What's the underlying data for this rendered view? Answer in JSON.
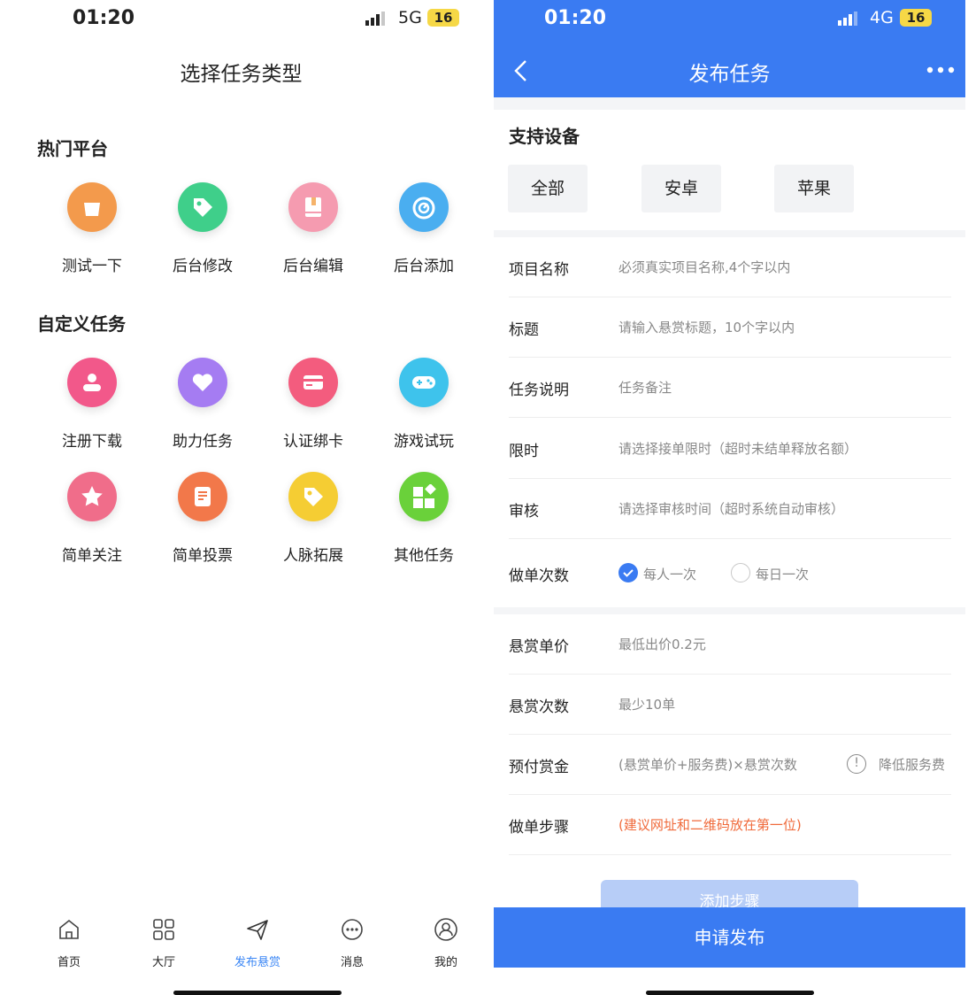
{
  "left": {
    "status": {
      "time": "01:20",
      "network": "5G",
      "battery": "16"
    },
    "title": "选择任务类型",
    "hot_title": "热门平台",
    "hot_items": [
      {
        "label": "测试一下",
        "icon": "shopping-bag-icon",
        "color": "#f39a4c"
      },
      {
        "label": "后台修改",
        "icon": "tag-icon",
        "color": "#3fcf8a"
      },
      {
        "label": "后台编辑",
        "icon": "book-icon",
        "color": "#f59bb0"
      },
      {
        "label": "后台添加",
        "icon": "gauge-icon",
        "color": "#4aaef0"
      }
    ],
    "custom_title": "自定义任务",
    "custom_items": [
      {
        "label": "注册下载",
        "icon": "user-icon",
        "color": "#f2588a"
      },
      {
        "label": "助力任务",
        "icon": "heart-icon",
        "color": "#a57cf2"
      },
      {
        "label": "认证绑卡",
        "icon": "card-icon",
        "color": "#f35c7e"
      },
      {
        "label": "游戏试玩",
        "icon": "gamepad-icon",
        "color": "#3ec3ec"
      },
      {
        "label": "简单关注",
        "icon": "star-icon",
        "color": "#f06d8a"
      },
      {
        "label": "简单投票",
        "icon": "document-icon",
        "color": "#f2784a"
      },
      {
        "label": "人脉拓展",
        "icon": "tag-icon",
        "color": "#f5cd33"
      },
      {
        "label": "其他任务",
        "icon": "apps-icon",
        "color": "#6ad13a"
      }
    ],
    "tabs": [
      {
        "label": "首页",
        "icon": "home-icon"
      },
      {
        "label": "大厅",
        "icon": "grid-icon"
      },
      {
        "label": "发布悬赏",
        "icon": "send-icon"
      },
      {
        "label": "消息",
        "icon": "chat-icon"
      },
      {
        "label": "我的",
        "icon": "profile-icon"
      }
    ],
    "active_tab": "发布悬赏"
  },
  "right": {
    "status": {
      "time": "01:20",
      "network": "4G",
      "battery": "16"
    },
    "title": "发布任务",
    "device_section": "支持设备",
    "devices": [
      "全部",
      "安卓",
      "苹果"
    ],
    "rows": [
      {
        "key": "项目名称",
        "value": "必须真实项目名称,4个字以内"
      },
      {
        "key": "标题",
        "value": "请输入悬赏标题，10个字以内"
      },
      {
        "key": "任务说明",
        "value": "任务备注"
      },
      {
        "key": "限时",
        "value": "请选择接单限时（超时未结单释放名额）"
      },
      {
        "key": "审核",
        "value": "请选择审核时间（超时系统自动审核）"
      }
    ],
    "times": {
      "key": "做单次数",
      "option_1": "每人一次",
      "option_2": "每日一次",
      "selected": "每人一次"
    },
    "rows2": [
      {
        "key": "悬赏单价",
        "value": "最低出价0.2元"
      },
      {
        "key": "悬赏次数",
        "value": "最少10单"
      }
    ],
    "prepay": {
      "key": "预付赏金",
      "value": "(悬赏单价+服务费)×悬赏次数",
      "tip": "降低服务费"
    },
    "steps": {
      "key": "做单步骤",
      "value": "(建议网址和二维码放在第一位)"
    },
    "add_step": "添加步骤",
    "submit": "申请发布",
    "colors": {
      "accent": "#3a7bf2",
      "hint_red": "#f06a3b"
    }
  }
}
